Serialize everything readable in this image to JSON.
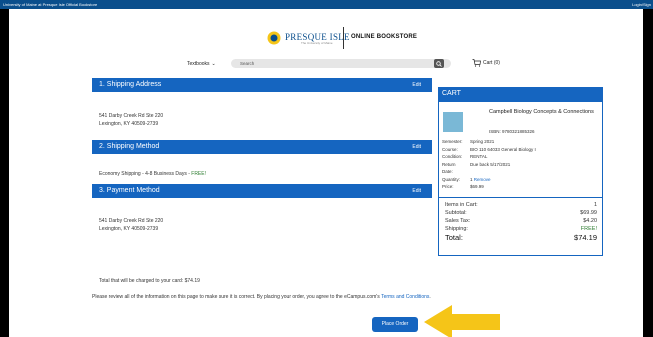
{
  "topbar": {
    "left_text": "University of Maine at Presque Isle Official Bookstore",
    "right_text": "Login/Sign"
  },
  "logo": {
    "school": "PRESQUE ISLE",
    "school_sub": "The University of Maine",
    "store": "ONLINE BOOKSTORE"
  },
  "nav": {
    "textbooks_label": "Textbooks",
    "search_placeholder": "Search",
    "cart_label": "Cart (0)"
  },
  "shipping_address": {
    "title": "1. Shipping Address",
    "edit": "Edit",
    "line1": "541 Darby Creek Rd Ste 220",
    "line2": "Lexington, KY 40509-2739"
  },
  "shipping_method": {
    "title": "2. Shipping Method",
    "edit": "Edit",
    "text": "Economy Shipping - 4-8 Business Days - ",
    "free": "FREE!"
  },
  "payment_method": {
    "title": "3. Payment Method",
    "edit": "Edit",
    "line1": "541 Darby Creek Rd Ste 220",
    "line2": "Lexington, KY 40509-2739"
  },
  "total_charged": "Total that will be charged to your card: $74.19",
  "review": {
    "text": "Please review all of the information on this page to make sure it is correct. By placing your order, you agree to the eCampus.com's ",
    "link": "Terms and Conditions",
    "end": "."
  },
  "place_order": "Place Order",
  "cart": {
    "header": "CART",
    "book_title": "Campbell Biology Concepts & Connections",
    "isbn": "ISBN: 9780321885326",
    "details": [
      {
        "k": "Semester:",
        "v": "Spring 2021"
      },
      {
        "k": "Course:",
        "v": "BIO 110 64033 General Biology I"
      },
      {
        "k": "Condition:",
        "v": "RENTAL"
      },
      {
        "k": "Return",
        "v": "Due back 5/17/2021"
      },
      {
        "k": "Date:",
        "v": ""
      },
      {
        "k": "Quantity:",
        "v": "1",
        "remove": "Remove"
      },
      {
        "k": "Price:",
        "v": "$69.99"
      }
    ],
    "summary": {
      "items_label": "Items in Cart:",
      "items_value": "1",
      "subtotal_label": "Subtotal:",
      "subtotal_value": "$69.99",
      "tax_label": "Sales Tax:",
      "tax_value": "$4.20",
      "shipping_label": "Shipping:",
      "shipping_value": "FREE!",
      "total_label": "Total:",
      "total_value": "$74.19"
    }
  },
  "colors": {
    "brand_blue": "#1565c0",
    "free_green": "#2e7d32",
    "arrow_yellow": "#f5c518"
  }
}
